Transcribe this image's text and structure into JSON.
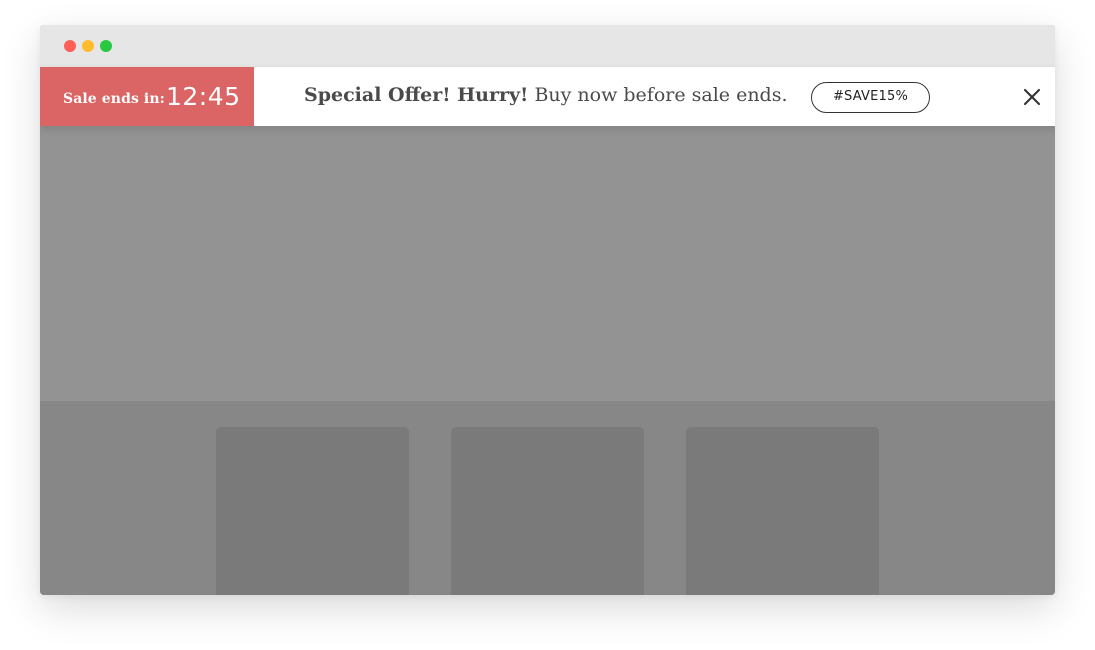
{
  "window": {
    "controls": [
      "close-dot",
      "minimize-dot",
      "zoom-dot"
    ]
  },
  "banner": {
    "countdown_label": "Sale ends in:",
    "countdown_time": "12:45",
    "offer_bold": "Special Offer! Hurry!",
    "offer_text": " Buy now before sale ends.",
    "coupon_code": "#SAVE15%",
    "close_icon": "close-icon"
  },
  "colors": {
    "countdown_background": "#db6464",
    "banner_background": "#ffffff",
    "page_overlay": "#939393"
  }
}
